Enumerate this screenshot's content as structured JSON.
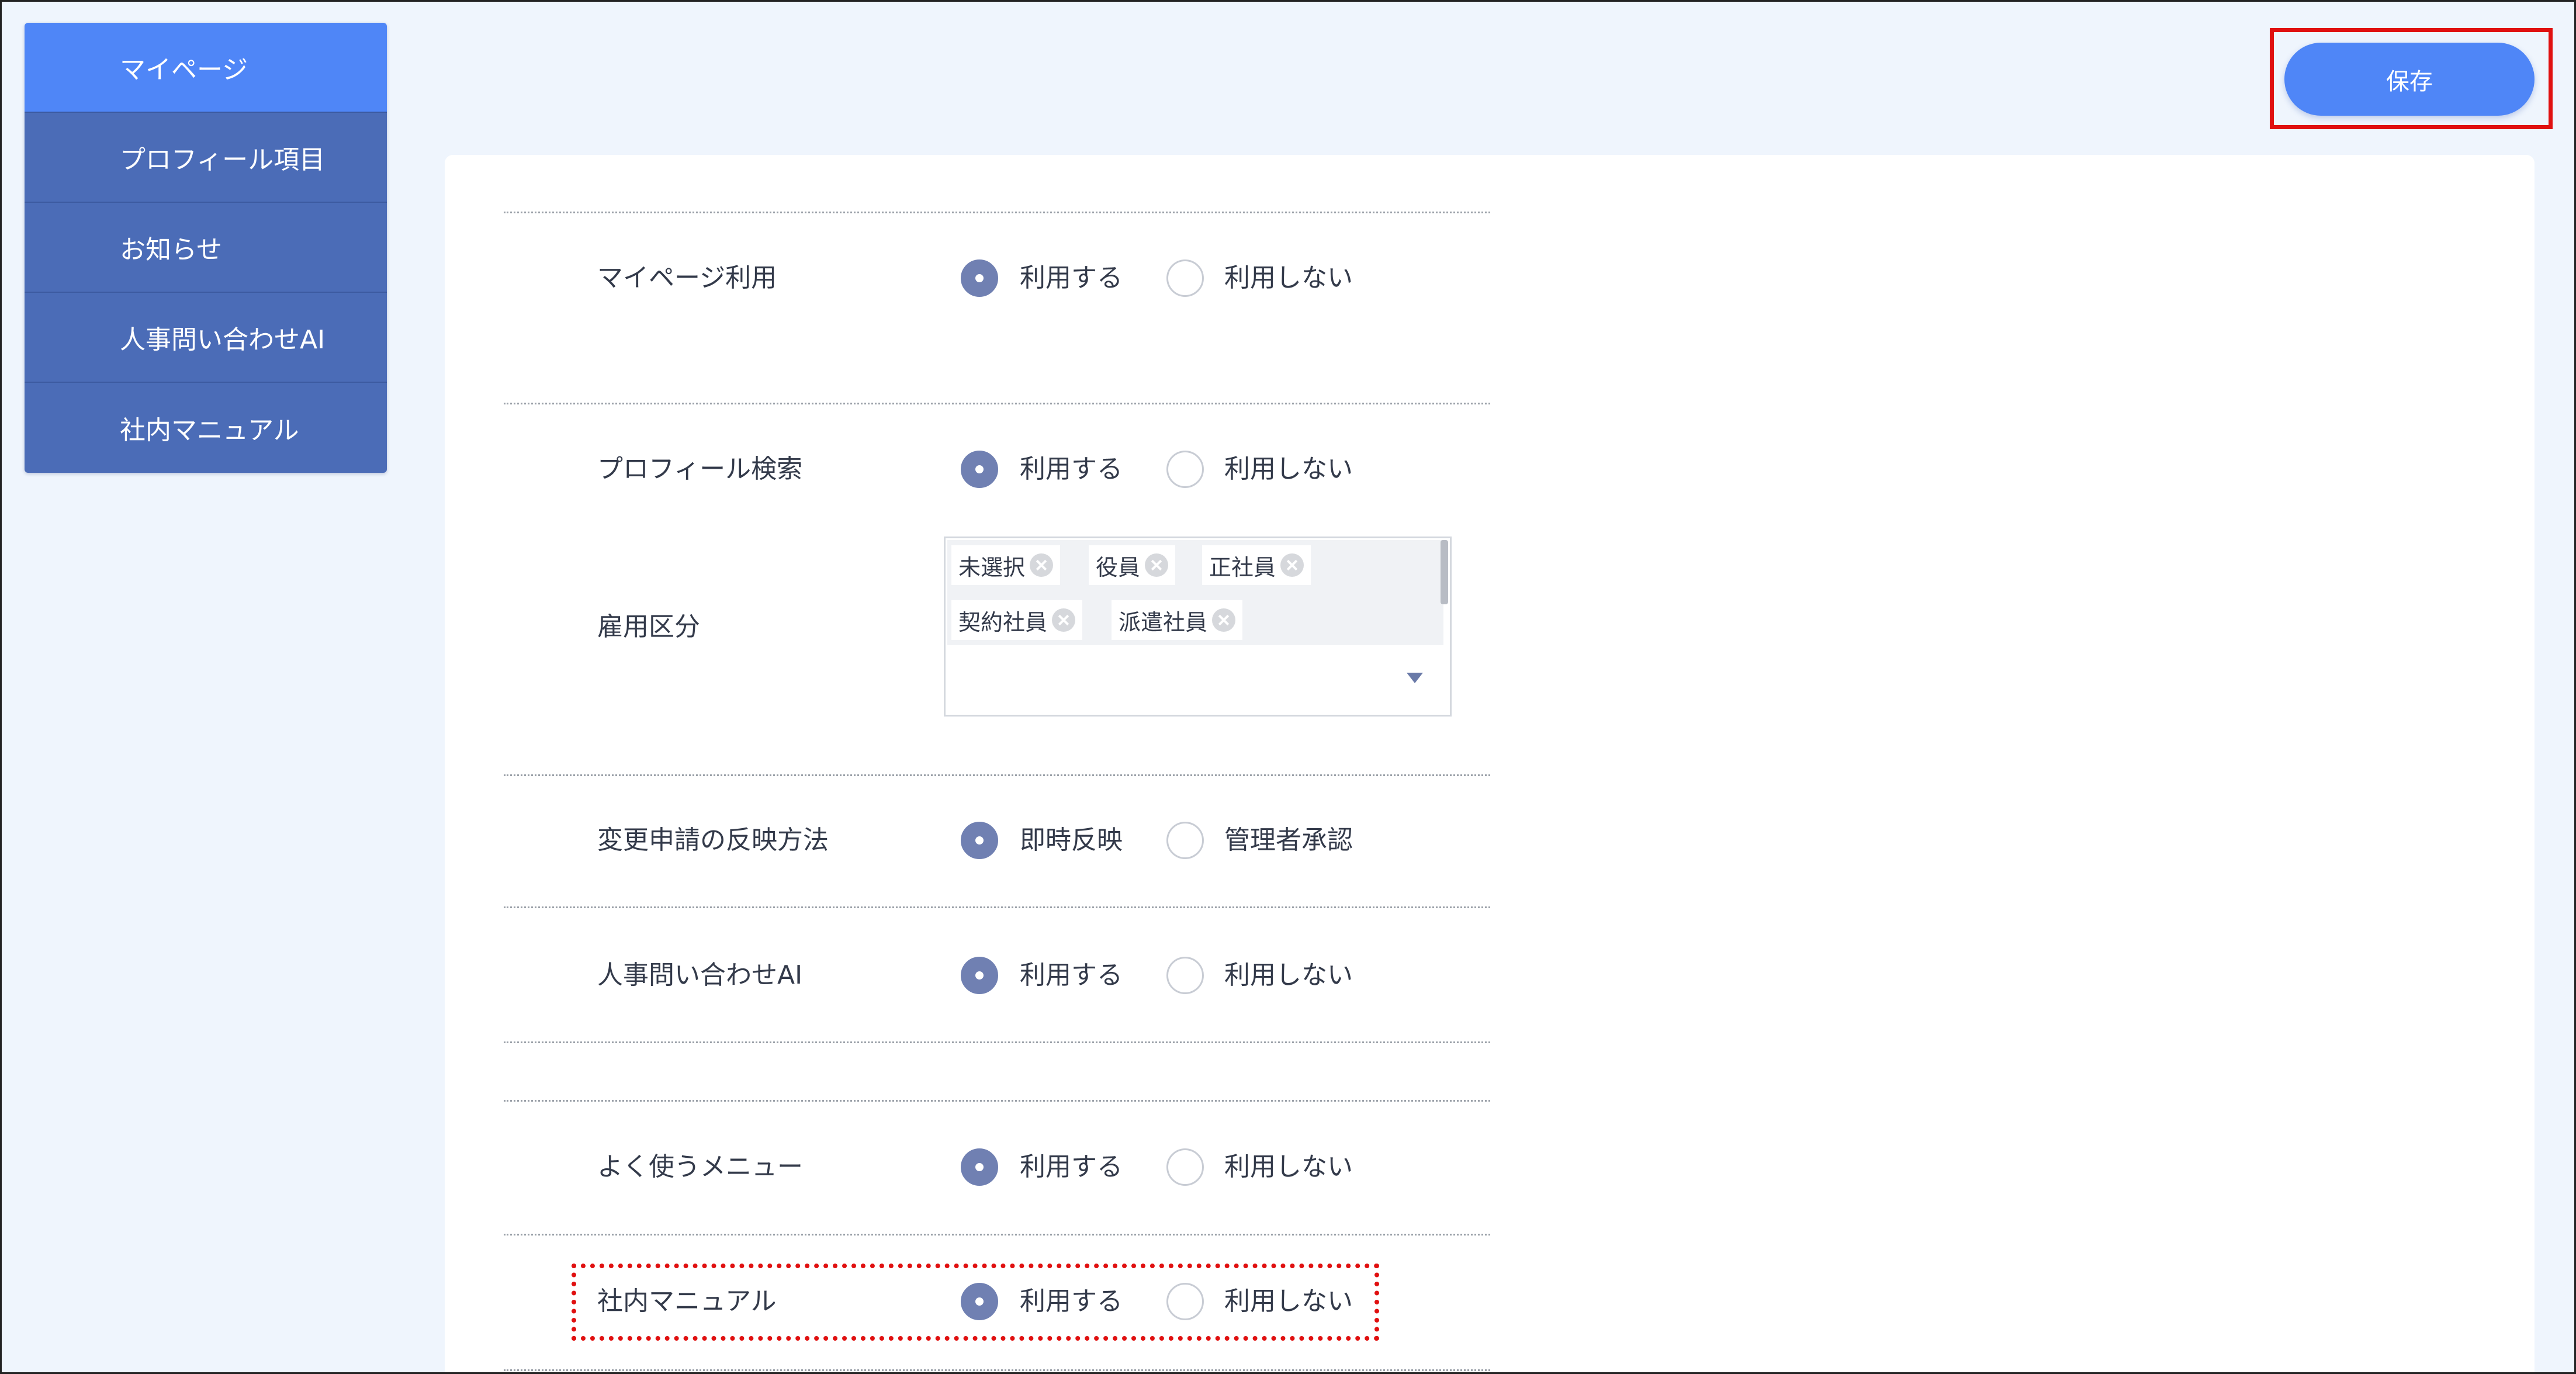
{
  "sidebar": {
    "items": [
      {
        "label": "マイページ",
        "active": true
      },
      {
        "label": "プロフィール項目",
        "active": false
      },
      {
        "label": "お知らせ",
        "active": false
      },
      {
        "label": "人事問い合わせAI",
        "active": false
      },
      {
        "label": "社内マニュアル",
        "active": false
      }
    ]
  },
  "toolbar": {
    "save_label": "保存"
  },
  "settings": {
    "mypage": {
      "label": "マイページ利用",
      "options": [
        "利用する",
        "利用しない"
      ],
      "selected": "利用する"
    },
    "profile_search": {
      "label": "プロフィール検索",
      "options": [
        "利用する",
        "利用しない"
      ],
      "selected": "利用する"
    },
    "employment_type": {
      "label": "雇用区分",
      "tags": [
        "未選択",
        "役員",
        "正社員",
        "契約社員",
        "派遣社員"
      ]
    },
    "change_request": {
      "label": "変更申請の反映方法",
      "options": [
        "即時反映",
        "管理者承認"
      ],
      "selected": "即時反映"
    },
    "hr_ai": {
      "label": "人事問い合わせAI",
      "options": [
        "利用する",
        "利用しない"
      ],
      "selected": "利用する"
    },
    "frequent_menu": {
      "label": "よく使うメニュー",
      "options": [
        "利用する",
        "利用しない"
      ],
      "selected": "利用する"
    },
    "internal_manual": {
      "label": "社内マニュアル",
      "options": [
        "利用する",
        "利用しない"
      ],
      "selected": "利用する"
    }
  },
  "colors": {
    "accent": "#4f86f7",
    "sidebar": "#4b6cb7",
    "radio_selected": "#7080b2",
    "highlight": "#e01010",
    "background": "#eff5fd"
  }
}
